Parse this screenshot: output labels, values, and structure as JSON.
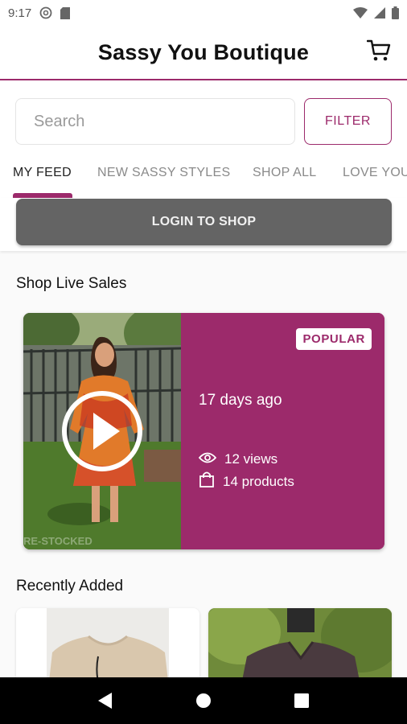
{
  "status_bar": {
    "time": "9:17",
    "icons_left": [
      "at-sign-icon",
      "sd-card-icon"
    ],
    "icons_right": [
      "wifi-icon",
      "signal-icon",
      "battery-icon"
    ]
  },
  "header": {
    "title": "Sassy You Boutique",
    "cart_icon": "shopping-cart-icon"
  },
  "search": {
    "placeholder": "Search",
    "value": "",
    "filter_label": "FILTER"
  },
  "tabs": [
    {
      "label": "MY FEED",
      "active": true
    },
    {
      "label": "NEW SASSY STYLES",
      "active": false
    },
    {
      "label": "SHOP ALL",
      "active": false
    },
    {
      "label": "LOVE YOU",
      "active": false
    }
  ],
  "login": {
    "label": "LOGIN TO SHOP"
  },
  "live_sales": {
    "section_title": "Shop Live Sales",
    "card": {
      "badge": "POPULAR",
      "posted": "17 days ago",
      "views": "12 views",
      "products": "14 products",
      "watermark": "RE-STOCKED",
      "play_icon": "play-icon"
    }
  },
  "recently_added": {
    "section_title": "Recently Added"
  },
  "nav": {
    "back_icon": "back-triangle-icon",
    "home_icon": "home-circle-icon",
    "recents_icon": "recents-square-icon"
  },
  "colors": {
    "brand": "#9c2a6b",
    "login_bg": "#646464",
    "nav_bg": "#000000"
  }
}
